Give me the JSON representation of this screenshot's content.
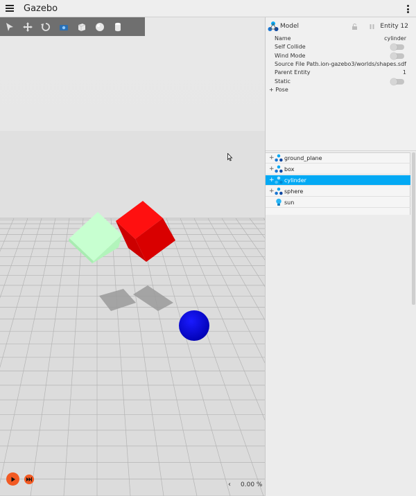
{
  "app": {
    "title": "Gazebo"
  },
  "toolbar": {
    "tools": [
      {
        "name": "select-tool-icon"
      },
      {
        "name": "translate-tool-icon"
      },
      {
        "name": "rotate-tool-icon"
      },
      {
        "name": "screenshot-tool-icon"
      },
      {
        "name": "box-shape-icon"
      },
      {
        "name": "sphere-shape-icon"
      },
      {
        "name": "cylinder-shape-icon"
      }
    ]
  },
  "scene": {
    "colors": {
      "sky": "#e6e6e6",
      "ground": "#dcdcdc",
      "grid": "#b4b4b4",
      "red_box": "#e60000",
      "green_box": "#b9ffc4",
      "sphere": "#0000e6"
    }
  },
  "playback": {
    "play_icon": "play-icon",
    "step_icon": "step-icon",
    "rtf_chevron": "‹",
    "rtf_value": "0.00 %"
  },
  "inspector": {
    "title": "Model",
    "entity_label": "Entity 12",
    "properties": [
      {
        "label": "Name",
        "value": "cylinder",
        "type": "text"
      },
      {
        "label": "Self Collide",
        "value": "off",
        "type": "toggle"
      },
      {
        "label": "Wind Mode",
        "value": "off",
        "type": "toggle"
      },
      {
        "label": "Source File Path",
        "value": "...ion-gazebo3/worlds/shapes.sdf",
        "type": "text"
      },
      {
        "label": "Parent Entity",
        "value": "1",
        "type": "text"
      },
      {
        "label": "Static",
        "value": "off",
        "type": "toggle"
      }
    ],
    "pose_label": "+ Pose"
  },
  "entity_tree": {
    "items": [
      {
        "label": "ground_plane",
        "expand": "+",
        "icon": "model-icon",
        "selected": false
      },
      {
        "label": "box",
        "expand": "+",
        "icon": "model-icon",
        "selected": false
      },
      {
        "label": "cylinder",
        "expand": "+",
        "icon": "model-icon",
        "selected": true
      },
      {
        "label": "sphere",
        "expand": "+",
        "icon": "model-icon",
        "selected": false
      },
      {
        "label": "sun",
        "expand": "",
        "icon": "light-bulb-icon",
        "selected": false
      }
    ],
    "accent": "#03a9f4"
  }
}
